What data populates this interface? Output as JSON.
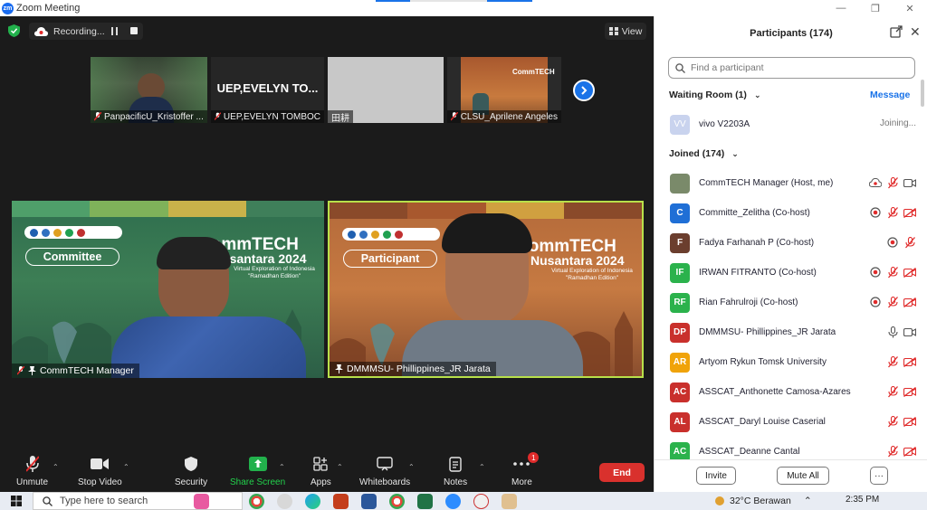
{
  "window": {
    "title": "Zoom Meeting",
    "logo_text": "zm"
  },
  "topbar": {
    "recording_label": "Recording...",
    "view_label": "View"
  },
  "thumbnails": [
    {
      "name": "PanpacificU_Kristoffer ...",
      "muted": true
    },
    {
      "name": "UEP,EVELYN TOMBOC",
      "display_name": "UEP,EVELYN TO...",
      "muted": true
    },
    {
      "name": "田耕",
      "muted": false
    },
    {
      "name": "CLSU_Aprilene Angeles",
      "muted": true
    }
  ],
  "tiles": [
    {
      "name": "CommTECH Manager",
      "role": "Committee",
      "event_title": "CommTECH",
      "event_sub": "Nusantara 2024",
      "event_desc": "Virtual Exploration of Indonesia \"Ramadhan Edition\""
    },
    {
      "name": "DMMMSU- Phillippines_JR Jarata",
      "role": "Participant",
      "event_title": "CommTECH",
      "event_sub": "Nusantara 2024",
      "event_desc": "Virtual Exploration of Indonesia \"Ramadhan Edition\""
    }
  ],
  "toolbar": {
    "unmute": "Unmute",
    "stop_video": "Stop Video",
    "security": "Security",
    "share_screen": "Share Screen",
    "apps": "Apps",
    "whiteboards": "Whiteboards",
    "notes": "Notes",
    "more": "More",
    "more_badge": "1",
    "end": "End"
  },
  "panel": {
    "title": "Participants (174)",
    "search_placeholder": "Find a participant",
    "waiting_room": "Waiting Room (1)",
    "message": "Message",
    "joined": "Joined (174)",
    "waiting": [
      {
        "initials": "VV",
        "name": "vivo V2203A",
        "status": "Joining..."
      }
    ],
    "participants": [
      {
        "initials": "",
        "name": "CommTECH Manager (Host, me)",
        "color": "#7a8a6a",
        "icons": [
          "cloud-rec",
          "mic-off",
          "video-on"
        ]
      },
      {
        "initials": "C",
        "name": "Committe_Zelitha (Co-host)",
        "color": "#1f6fd6",
        "icons": [
          "rec",
          "mic-off",
          "video-off"
        ]
      },
      {
        "initials": "F",
        "name": "Fadya Farhanah P (Co-host)",
        "color": "#6b3e2e",
        "icons": [
          "rec",
          "mic-off"
        ]
      },
      {
        "initials": "IF",
        "name": "IRWAN FITRANTO (Co-host)",
        "color": "#2bb24c",
        "icons": [
          "rec",
          "mic-off",
          "video-off"
        ]
      },
      {
        "initials": "RF",
        "name": "Rian Fahrulroji (Co-host)",
        "color": "#2bb24c",
        "icons": [
          "rec",
          "mic-off",
          "video-off"
        ]
      },
      {
        "initials": "DP",
        "name": "DMMMSU- Phillippines_JR Jarata",
        "color": "#c9302c",
        "icons": [
          "mic-on",
          "video-on"
        ]
      },
      {
        "initials": "AR",
        "name": "Artyom Rykun Tomsk University",
        "color": "#f0a30a",
        "icons": [
          "mic-off",
          "video-off"
        ]
      },
      {
        "initials": "AC",
        "name": "ASSCAT_Anthonette Camosa-Azares",
        "color": "#c9302c",
        "icons": [
          "mic-off",
          "video-off"
        ]
      },
      {
        "initials": "AL",
        "name": "ASSCAT_Daryl Louise Caserial",
        "color": "#c9302c",
        "icons": [
          "mic-off",
          "video-off"
        ]
      },
      {
        "initials": "AC",
        "name": "ASSCAT_Deanne Cantal",
        "color": "#2bb24c",
        "icons": [
          "mic-off",
          "video-off"
        ]
      }
    ],
    "invite": "Invite",
    "mute_all": "Mute All",
    "more_dots": "···"
  },
  "taskbar": {
    "search_placeholder": "Type here to search",
    "weather": "32°C  Berawan",
    "time": "2:35 PM"
  }
}
